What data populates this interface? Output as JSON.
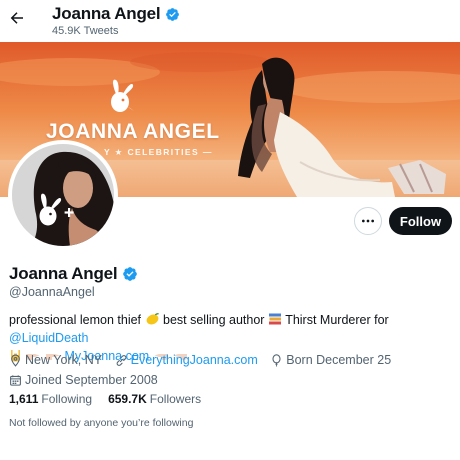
{
  "header": {
    "back_icon": "arrow-left-icon",
    "name": "Joanna Angel",
    "tweets": "45.9K Tweets"
  },
  "banner": {
    "title": "JOANNA ANGEL",
    "caption": "Y ★ CELEBRITIES —",
    "logo_icon": "playboy-bunny-icon",
    "colors": {
      "sky": "#e8743a",
      "ground": "#f3b07a"
    }
  },
  "profile": {
    "name": "Joanna Angel",
    "handle": "@JoannaAngel",
    "verified_color": "#1d9bf0",
    "avatar_icon": "playboy-bunny-plus-icon"
  },
  "actions": {
    "more_icon": "more-horizontal-icon",
    "follow_label": "Follow"
  },
  "bio": {
    "part1": "professional lemon thief",
    "part2": "best selling author",
    "part3": "Thirst Murderer for",
    "mention": "@LiquidDeath",
    "link": "MyJoanna.com",
    "emojis": [
      "lemon",
      "books",
      "rock-on-hand",
      "pointing-right-hand",
      "pointing-left-hand"
    ]
  },
  "meta": {
    "location": "New York, NY",
    "website": "EverythingJoanna.com",
    "born": "Born December 25",
    "joined": "Joined September 2008"
  },
  "stats": {
    "following_count": "1,611",
    "following_label": "Following",
    "followers_count": "659.7K",
    "followers_label": "Followers"
  },
  "not_followed": "Not followed by anyone you’re following"
}
